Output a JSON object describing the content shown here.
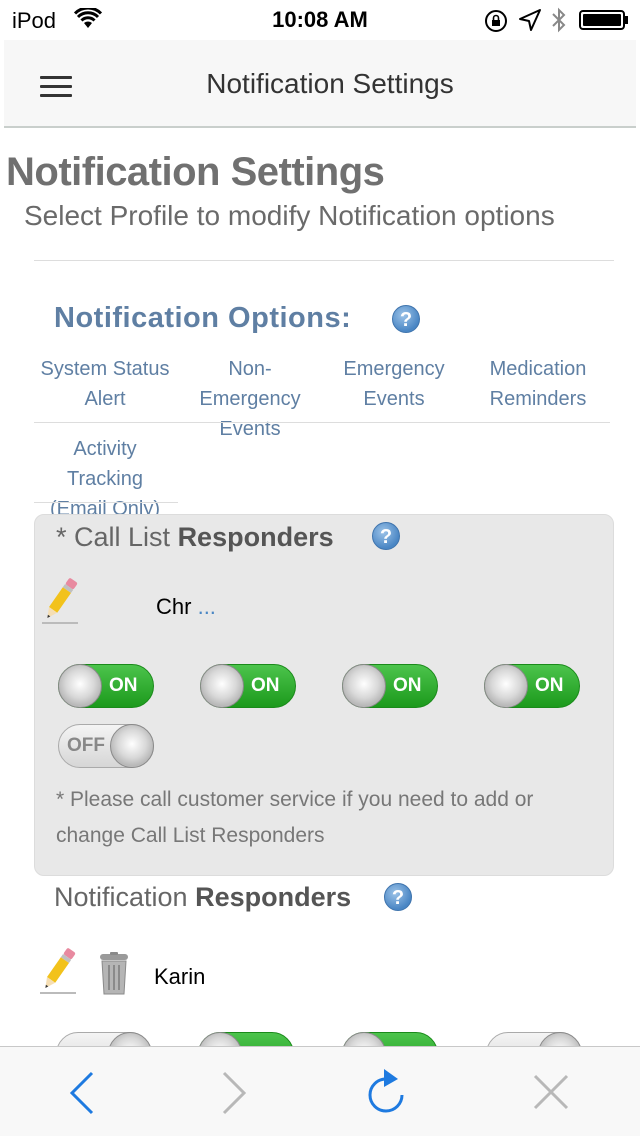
{
  "status_bar": {
    "carrier": "iPod",
    "time": "10:08 AM"
  },
  "nav": {
    "title": "Notification Settings"
  },
  "page": {
    "title": "Notification Settings",
    "subtitle": "Select Profile to modify Notification options"
  },
  "options": {
    "heading": "Notification Options:",
    "help": "?",
    "columns": [
      {
        "line1": "System Status",
        "line2": "Alert",
        "line3": ""
      },
      {
        "line1": "Non-",
        "line2": "Emergency",
        "line3": "Events"
      },
      {
        "line1": "Emergency",
        "line2": "Events",
        "line3": ""
      },
      {
        "line1": "Medication",
        "line2": "Reminders",
        "line3": ""
      },
      {
        "line1": "Activity",
        "line2": "Tracking",
        "line3": "(Email Only)"
      }
    ]
  },
  "call_list": {
    "prefix": "*  Call List",
    "strong": "Responders",
    "help": "?",
    "name": "Chr",
    "more": "...",
    "toggles": [
      {
        "state": "ON"
      },
      {
        "state": "ON"
      },
      {
        "state": "ON"
      },
      {
        "state": "ON"
      },
      {
        "state": "OFF"
      }
    ],
    "note": "*  Please call customer service if you need to add or change Call List Responders"
  },
  "notification_responders": {
    "prefix": "Notification",
    "strong": "Responders",
    "help": "?",
    "name": "Karin"
  },
  "colors": {
    "accent": "#5f7fa3",
    "toggle_on": "#2aa82a",
    "ios_blue": "#1e7ae0"
  },
  "icons": [
    "wifi-icon",
    "rotation-lock-icon",
    "location-icon",
    "bluetooth-icon",
    "battery-icon",
    "hamburger-icon",
    "help-icon",
    "pencil-icon",
    "trash-icon",
    "back-icon",
    "forward-icon",
    "reload-icon",
    "close-icon"
  ]
}
